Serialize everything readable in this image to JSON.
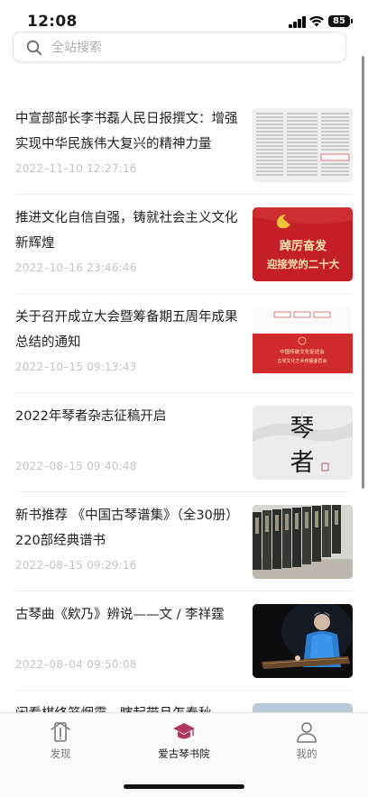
{
  "status_bar": {
    "time": "12:08",
    "battery": "85"
  },
  "search": {
    "placeholder": "全站搜索"
  },
  "articles": [
    {
      "title": "中宣部部长李书磊人民日报撰文：增强实现中华民族伟大复兴的精神力量",
      "date": "2022–11–10 12:27:16",
      "thumb": "newspaper-image"
    },
    {
      "title": "推进文化自信自强，铸就社会主义文化新辉煌",
      "date": "2022–10–16 23:46:46",
      "thumb": "party-poster-image",
      "thumb_text": [
        "踔厉奋发",
        "迎接党的二十大"
      ]
    },
    {
      "title": "关于召开成立大会暨筹备期五周年成果总结的通知",
      "date": "2022–10–15 09:13:43",
      "thumb": "notice-poster-image",
      "thumb_text": [
        "中国传统文化促进会",
        "古琴文化艺术传播委员会"
      ]
    },
    {
      "title": "2022年琴者杂志征稿开启",
      "date": "2022–08–15 09:40:48",
      "thumb": "calligraphy-image",
      "thumb_text": [
        "琴",
        "者"
      ]
    },
    {
      "title": "新书推荐 《中国古琴谱集》（全30册）220部经典谱书",
      "date": "2022–08–15 09:29:16",
      "thumb": "bookshelf-image"
    },
    {
      "title": "古琴曲《欸乃》辨说——文 / 李祥霆",
      "date": "2022–08–04 09:50:08",
      "thumb": "guqin-player-image"
    },
    {
      "title": "闲看棋终笼烟霭，瞎起带月怎春秋——古",
      "date": "",
      "thumb": "partial-image"
    }
  ],
  "tabbar": {
    "tabs": [
      {
        "label": "发现",
        "icon": "upload-icon"
      },
      {
        "label": "爱古琴书院",
        "icon": "graduation-cap-icon"
      },
      {
        "label": "我的",
        "icon": "user-icon"
      }
    ],
    "active": 1
  },
  "colors": {
    "accent": "#b0385e",
    "tab_active_icon": "#b0385e",
    "date_text": "#c4c4c4",
    "poster_red": "#c8202b"
  }
}
